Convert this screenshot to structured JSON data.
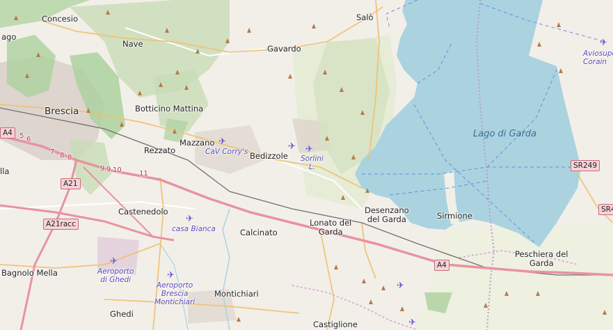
{
  "map": {
    "lake_name": "Lago di Garda",
    "places": {
      "concesio": "Concesio",
      "nave": "Nave",
      "gavardo": "Gavardo",
      "salo": "Salò",
      "brescia": "Brescia",
      "botticino_mattina": "Botticino Mattina",
      "mazzano": "Mazzano",
      "rezzato": "Rezzato",
      "bedizzole": "Bedizzole",
      "castenedolo": "Castenedolo",
      "calcinato": "Calcinato",
      "lonato_del_garda": "Lonato del\nGarda",
      "desenzano_del_garda": "Desenzano\ndel Garda",
      "sirmione": "Sirmione",
      "peschiera_del_garda": "Peschiera del\nGarda",
      "montichiari": "Montichiari",
      "ghedi": "Ghedi",
      "bagnolo_mella": "Bagnolo Mella",
      "castiglione": "Castiglione",
      "edge_left_top": "ago",
      "edge_left_mid": "lla"
    },
    "airports": {
      "cav_corrys": "CaV Corry's",
      "sorlini": "Sorlini\nL.",
      "casa_bianca": "casa Bianca",
      "aeroporto_di_ghedi": "Aeroporto\ndi Ghedi",
      "aeroporto_brescia_montichiari": "Aeroporto\nBrescia\nMontichiari",
      "aviosuperficie_corain": "Aviosuper\nCorain"
    },
    "road_shields": {
      "a4_left": "A4",
      "a21": "A21",
      "a21racc": "A21racc",
      "a4_center": "A4",
      "sr249": "SR249",
      "sr_edge": "SR4"
    },
    "junction_numbers": [
      "5",
      "6",
      "7",
      "8",
      "8",
      "9",
      "9",
      "10",
      "11"
    ],
    "colors": {
      "water": "#aad3df",
      "forest": "#add19e",
      "urban": "#d9d0c9",
      "motorway": "#e892a2",
      "primary_road": "#fcd6a4",
      "secondary_road": "#f7fabf",
      "peak": "#b8794a",
      "airport_label": "#5a4bb5",
      "boundary": "#b79ccd"
    }
  }
}
